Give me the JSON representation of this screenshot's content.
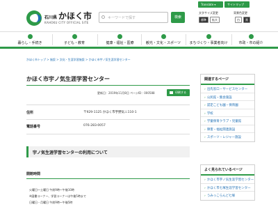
{
  "header": {
    "logo_small": "石川県",
    "logo_text": "かほく市",
    "logo_sub": "KAHOKU CITY OFFICIAL SITE",
    "search_placeholder": "キーワードで探す",
    "search_button": "検索",
    "translate": "Translate ▾",
    "sitemap": "サイトマップ",
    "font_size_label": "文字サイズ変更",
    "font_size_options": [
      "標準",
      "拡大"
    ],
    "bg_color_label": "背景色変更",
    "bg_color_options": [
      "白",
      "黒"
    ]
  },
  "nav": [
    {
      "label": "暮らし・手続き"
    },
    {
      "label": "子ども・教育"
    },
    {
      "label": "健康・福祉・医療"
    },
    {
      "label": "観光・文化・スポーツ"
    },
    {
      "label": "まちづくり・事業者向け"
    },
    {
      "label": "市政・市の紹介"
    }
  ],
  "breadcrumb": "かほく市トップ > 施設 > 文化・生涯学習施設 > かほく市宇ノ気生涯学習センター",
  "main": {
    "title": "かほく市宇ノ気生涯学習センター",
    "update": "更新日：2019年11月8日 ページID：000588",
    "print": "印刷する",
    "rows": [
      {
        "label": "住所",
        "value": "〒929-1125 かほく市宇野気ニ110-1"
      },
      {
        "label": "電話番号",
        "value": "076-283-0057"
      }
    ],
    "section": "宇ノ気生涯学習センターの利用について",
    "sub_head": "開館時間",
    "hours": [
      "火曜日～土曜日 午前9時～午後10時",
      "※図書コーナー、学習コーナーは午後5時まで",
      "日曜日・月曜日 午前9時～午後5時"
    ]
  },
  "sidebar": {
    "related": {
      "title": "関連するページ",
      "items": [
        "出先窓口・サービスセンター",
        "公民館・集会施設",
        "認定こども園・保育園",
        "学校",
        "学童保育クラブ・児童館",
        "障害・福祉関連施設",
        "スポーツ・レジャー施設"
      ]
    },
    "popular": {
      "title": "よく見られているページ",
      "items": [
        "かほく市宇ノ気生涯学習センター",
        "かほく市七塚生涯学習センター",
        "うみっこらんど七塚"
      ]
    }
  }
}
